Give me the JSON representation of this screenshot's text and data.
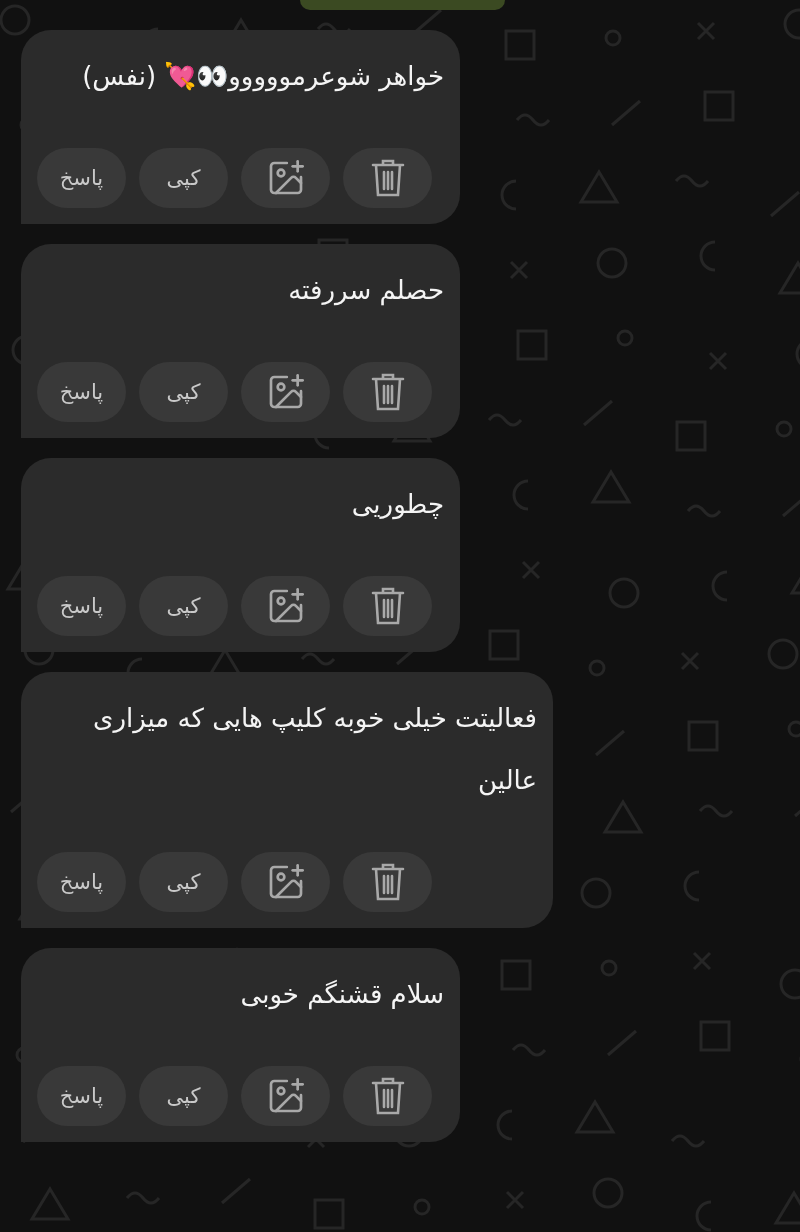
{
  "messages": [
    {
      "text": "خواهر شوعرمووووو👀💘 (نفس)",
      "actions": [
        {
          "kind": "delete"
        },
        {
          "kind": "add-image"
        },
        {
          "kind": "copy",
          "label": "کپی"
        },
        {
          "kind": "reply",
          "label": "پاسخ"
        }
      ]
    },
    {
      "text": "حصلم سررفته",
      "actions": [
        {
          "kind": "delete"
        },
        {
          "kind": "add-image"
        },
        {
          "kind": "copy",
          "label": "کپی"
        },
        {
          "kind": "reply",
          "label": "پاسخ"
        }
      ]
    },
    {
      "text": "چطوریی",
      "actions": [
        {
          "kind": "delete"
        },
        {
          "kind": "add-image"
        },
        {
          "kind": "copy",
          "label": "کپی"
        },
        {
          "kind": "reply",
          "label": "پاسخ"
        }
      ]
    },
    {
      "text": "فعالیتت خیلی خوبه کلیپ هایی که میزاری عالین",
      "actions": [
        {
          "kind": "delete"
        },
        {
          "kind": "add-image"
        },
        {
          "kind": "copy",
          "label": "کپی"
        },
        {
          "kind": "reply",
          "label": "پاسخ"
        }
      ]
    },
    {
      "text": "سلام قشنگم خوبی",
      "actions": [
        {
          "kind": "delete"
        },
        {
          "kind": "add-image"
        },
        {
          "kind": "copy",
          "label": "کپی"
        },
        {
          "kind": "reply",
          "label": "پاسخ"
        }
      ]
    }
  ]
}
